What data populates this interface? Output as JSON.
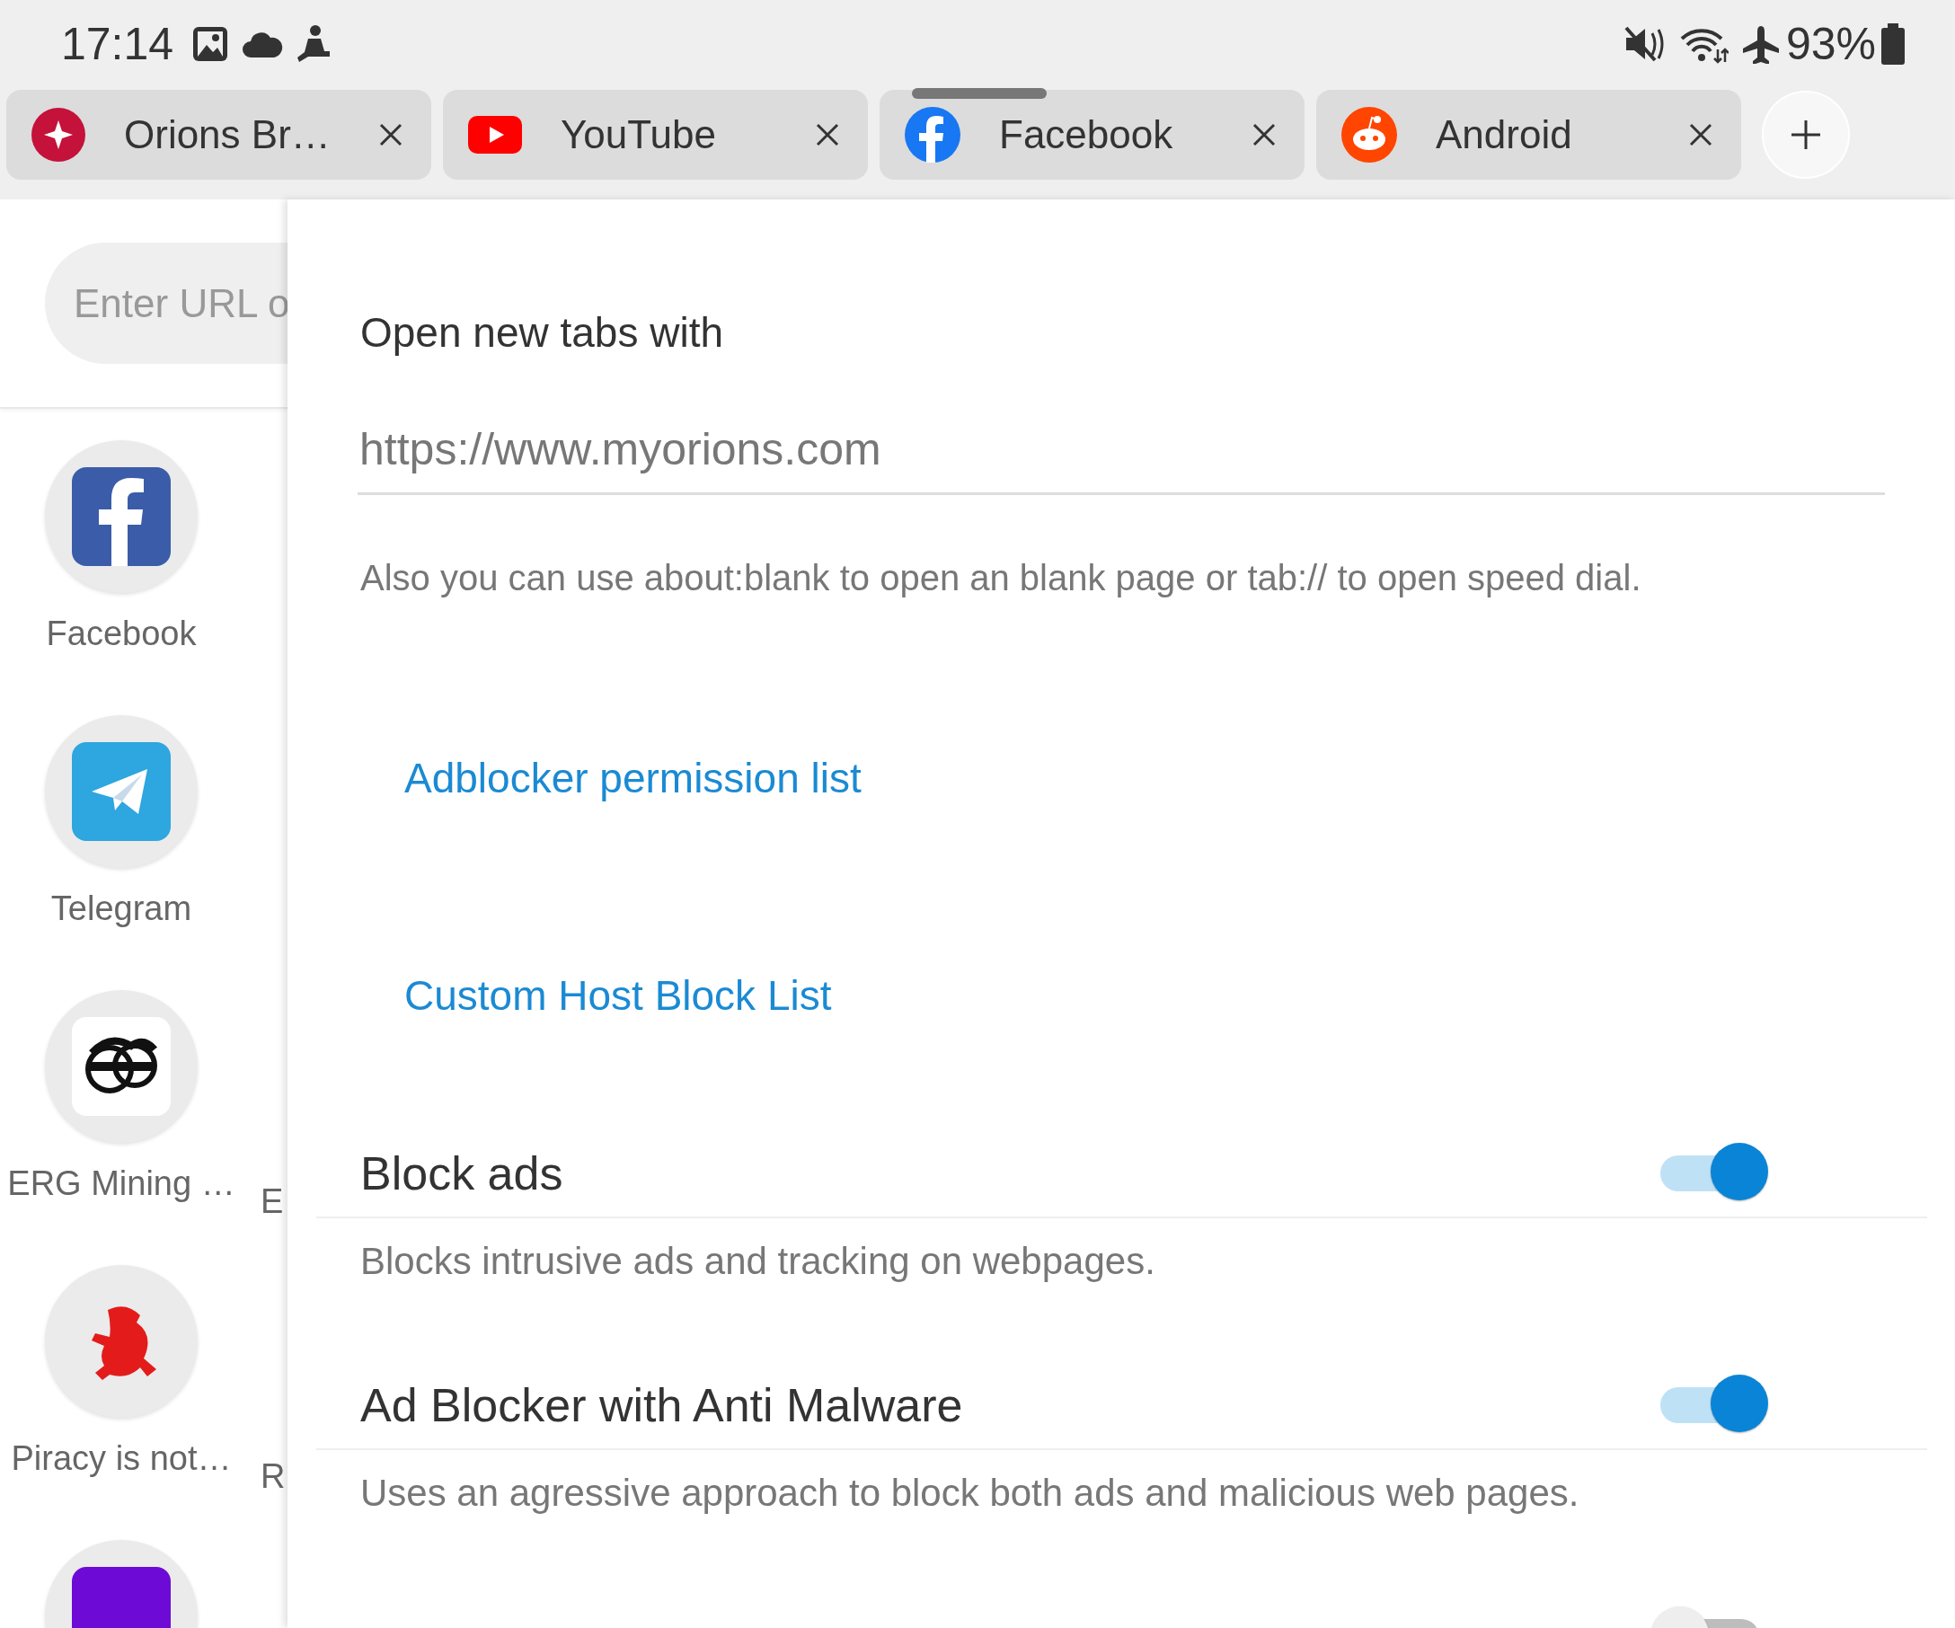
{
  "status_bar": {
    "time": "17:14",
    "battery": "93%"
  },
  "tabs": [
    {
      "title": "Orions Br…"
    },
    {
      "title": "YouTube"
    },
    {
      "title": "Facebook"
    },
    {
      "title": "Android"
    }
  ],
  "url_field": {
    "placeholder": "Enter URL o"
  },
  "speed_dial": [
    {
      "label": "Facebook"
    },
    {
      "label": "Telegram"
    },
    {
      "label": "ERG Mining …",
      "next_label": "E"
    },
    {
      "label": "Piracy is not…",
      "next_label": "R"
    },
    {
      "cut_off": true
    }
  ],
  "settings": {
    "new_tab": {
      "title": "Open new tabs with",
      "value": "https://www.myorions.com",
      "hint": "Also you can use about:blank to open an blank page or tab:// to open speed dial."
    },
    "links": [
      "Adblocker permission list",
      "Custom Host Block List"
    ],
    "toggles": [
      {
        "title": "Block ads",
        "description": "Blocks intrusive ads and tracking on webpages.",
        "on": true
      },
      {
        "title": "Ad Blocker with Anti Malware",
        "description": "Uses an agressive approach to block both ads and malicious web pages.",
        "on": true
      },
      {
        "on": false
      }
    ]
  }
}
